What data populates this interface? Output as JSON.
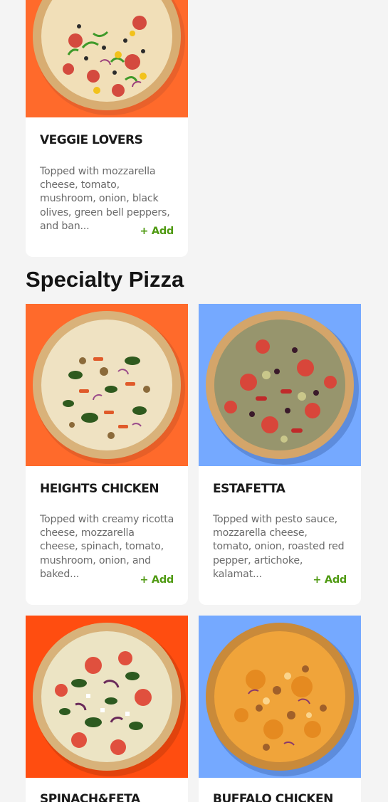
{
  "top_card": {
    "title": "VEGGIE LOVERS",
    "description": "Topped with mozzarella cheese, tomato, mushroom, onion, black olives, green bell peppers, and ban...",
    "add_label": "+ Add",
    "bg_color": "#ff6a2b"
  },
  "section": {
    "title": "Specialty Pizza"
  },
  "cards": [
    {
      "title": "HEIGHTS CHICKEN",
      "description": "Topped with creamy ricotta cheese, mozzarella cheese, spinach, tomato, mushroom, onion, and baked...",
      "add_label": "+ Add",
      "bg_color": "#ff6a2b"
    },
    {
      "title": "ESTAFETTA",
      "description": "Topped with pesto sauce, mozzarella cheese, tomato, onion, roasted red pepper, artichoke, kalamat...",
      "add_label": "+ Add",
      "bg_color": "#75a9ff"
    },
    {
      "title": "SPINACH&FETA",
      "bg_color": "#ff4d10"
    },
    {
      "title": "BUFFALO CHICKEN",
      "bg_color": "#75a9ff"
    }
  ],
  "colors": {
    "page_bg": "#f4f4f4",
    "add_green": "#4f9a12",
    "title": "#1a1a1a",
    "desc": "#6b6b6b"
  }
}
